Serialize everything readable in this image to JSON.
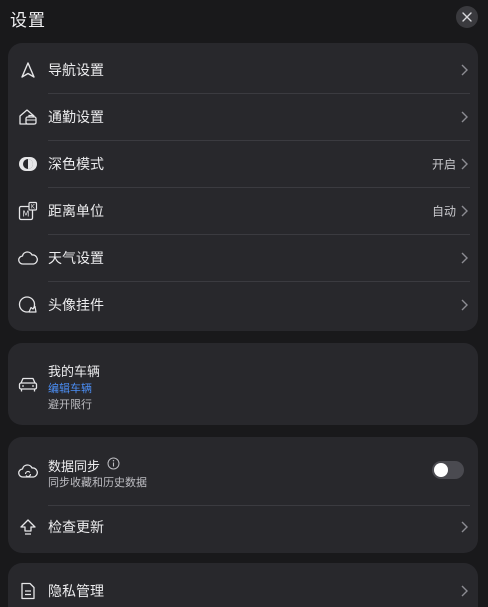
{
  "header": {
    "title": "设置",
    "close_icon": "close-icon"
  },
  "settings_group": {
    "items": [
      {
        "label": "导航设置",
        "value": "",
        "icon": "navigation-arrow-icon"
      },
      {
        "label": "通勤设置",
        "value": "",
        "icon": "commute-home-icon"
      },
      {
        "label": "深色模式",
        "value": "开启",
        "icon": "dark-mode-icon"
      },
      {
        "label": "距离单位",
        "value": "自动",
        "icon": "distance-unit-icon"
      },
      {
        "label": "天气设置",
        "value": "",
        "icon": "cloud-icon"
      },
      {
        "label": "头像挂件",
        "value": "",
        "icon": "avatar-pendant-icon"
      }
    ]
  },
  "vehicle": {
    "title": "我的车辆",
    "edit_label": "编辑车辆",
    "subtitle": "避开限行",
    "icon": "car-icon"
  },
  "sync_group": {
    "sync_title": "数据同步",
    "sync_subtitle": "同步收藏和历史数据",
    "sync_enabled": false,
    "update_label": "检查更新"
  },
  "privacy": {
    "label": "隐私管理"
  },
  "colors": {
    "background": "#19191b",
    "card": "#28282c",
    "accent_link": "#4b8ef5",
    "toggle_off": "#4a4a50"
  }
}
